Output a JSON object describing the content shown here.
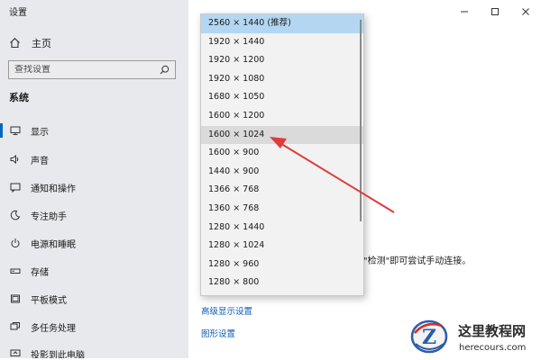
{
  "window": {
    "title": "设置",
    "controls": {
      "minimize": "minimize-icon",
      "maximize": "maximize-icon",
      "close": "close-icon"
    }
  },
  "sidebar": {
    "home_label": "主页",
    "search_placeholder": "查找设置",
    "section_title": "系统",
    "items": [
      {
        "label": "显示",
        "icon": "monitor-icon",
        "active": true
      },
      {
        "label": "声音",
        "icon": "speaker-icon",
        "active": false
      },
      {
        "label": "通知和操作",
        "icon": "notification-icon",
        "active": false
      },
      {
        "label": "专注助手",
        "icon": "moon-icon",
        "active": false
      },
      {
        "label": "电源和睡眠",
        "icon": "power-icon",
        "active": false
      },
      {
        "label": "存储",
        "icon": "storage-icon",
        "active": false
      },
      {
        "label": "平板模式",
        "icon": "tablet-icon",
        "active": false
      },
      {
        "label": "多任务处理",
        "icon": "multitask-icon",
        "active": false
      },
      {
        "label": "投影到此电脑",
        "icon": "project-icon",
        "active": false
      }
    ]
  },
  "main": {
    "connect_text": "\"检测\"即可尝试手动连接。",
    "links": [
      {
        "label": "高级显示设置"
      },
      {
        "label": "图形设置"
      }
    ]
  },
  "resolution_dropdown": {
    "selected": "2560 × 1440 (推荐)",
    "highlighted": "1600 × 1024",
    "options": [
      "2560 × 1440 (推荐)",
      "1920 × 1440",
      "1920 × 1200",
      "1920 × 1080",
      "1680 × 1050",
      "1600 × 1200",
      "1600 × 1024",
      "1600 × 900",
      "1440 × 900",
      "1366 × 768",
      "1360 × 768",
      "1280 × 1440",
      "1280 × 1024",
      "1280 × 960",
      "1280 × 800"
    ]
  },
  "annotation": {
    "color": "#e03a3a"
  },
  "watermark": {
    "title": "这里教程网",
    "url": "herecours.com",
    "logo_letter": "Z"
  },
  "colors": {
    "sidebar_bg": "#e7e9ec",
    "accent": "#0067c0",
    "link": "#0a5cb8",
    "selected_option": "#b3d7f2",
    "hovered_option": "#dadada"
  }
}
